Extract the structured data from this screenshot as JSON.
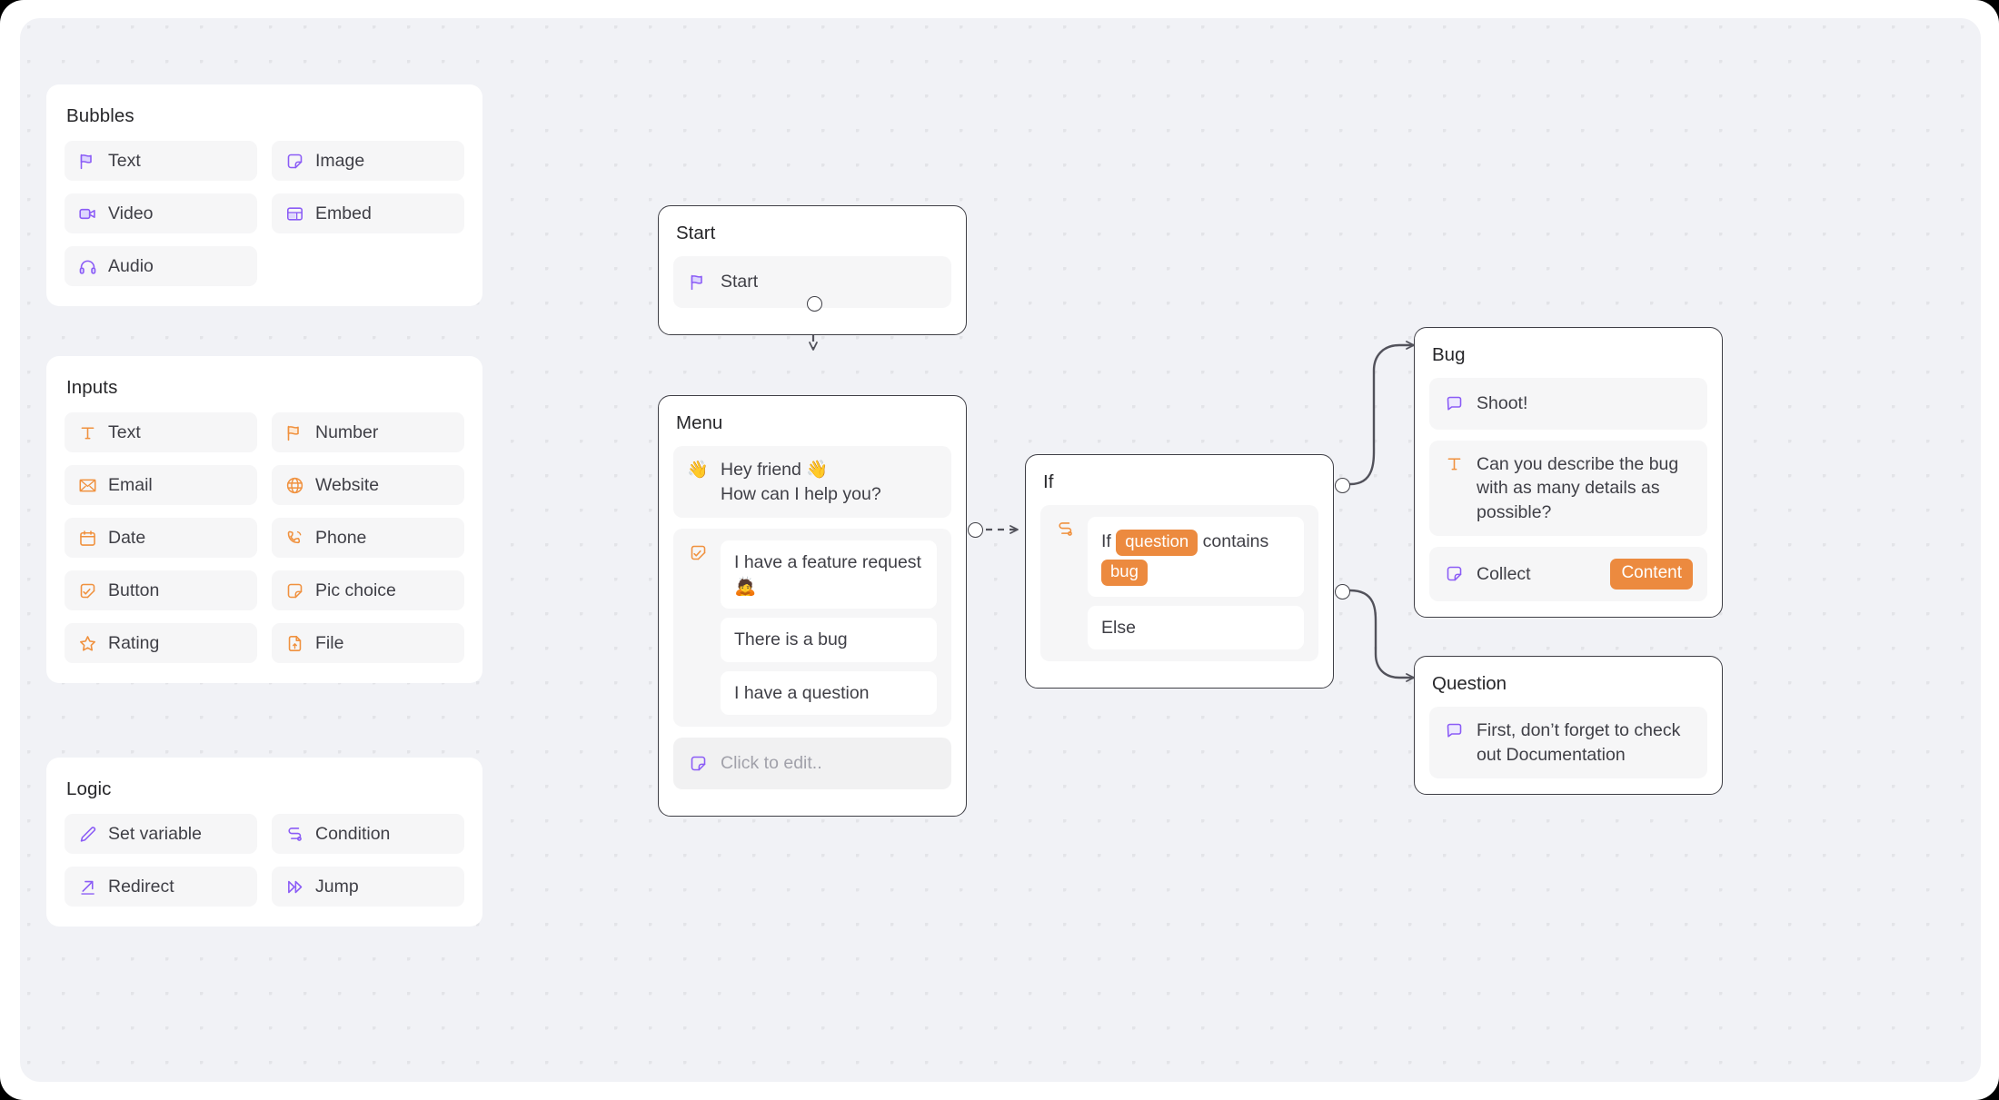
{
  "palette": {
    "sections": [
      {
        "title": "Bubbles",
        "items": [
          {
            "label": "Text",
            "icon": "flag-icon",
            "color": "#8b5cf6"
          },
          {
            "label": "Image",
            "icon": "sticker-icon",
            "color": "#8b5cf6"
          },
          {
            "label": "Video",
            "icon": "video-icon",
            "color": "#8b5cf6"
          },
          {
            "label": "Embed",
            "icon": "embed-icon",
            "color": "#8b5cf6"
          },
          {
            "label": "Audio",
            "icon": "headphones-icon",
            "color": "#8b5cf6"
          }
        ]
      },
      {
        "title": "Inputs",
        "items": [
          {
            "label": "Text",
            "icon": "text-t-icon",
            "color": "#f0913e"
          },
          {
            "label": "Number",
            "icon": "flag-icon",
            "color": "#f0913e"
          },
          {
            "label": "Email",
            "icon": "envelope-icon",
            "color": "#f0913e"
          },
          {
            "label": "Website",
            "icon": "globe-icon",
            "color": "#f0913e"
          },
          {
            "label": "Date",
            "icon": "calendar-icon",
            "color": "#f0913e"
          },
          {
            "label": "Phone",
            "icon": "phone-icon",
            "color": "#f0913e"
          },
          {
            "label": "Button",
            "icon": "button-check-icon",
            "color": "#f0913e"
          },
          {
            "label": "Pic choice",
            "icon": "sticker-icon",
            "color": "#f0913e"
          },
          {
            "label": "Rating",
            "icon": "star-icon",
            "color": "#f0913e"
          },
          {
            "label": "File",
            "icon": "file-upload-icon",
            "color": "#f0913e"
          }
        ]
      },
      {
        "title": "Logic",
        "items": [
          {
            "label": "Set variable",
            "icon": "pencil-icon",
            "color": "#8b5cf6"
          },
          {
            "label": "Condition",
            "icon": "condition-icon",
            "color": "#8b5cf6"
          },
          {
            "label": "Redirect",
            "icon": "arrow-up-right-icon",
            "color": "#8b5cf6"
          },
          {
            "label": "Jump",
            "icon": "jump-icon",
            "color": "#8b5cf6"
          }
        ]
      }
    ]
  },
  "flow": {
    "nodes": {
      "start": {
        "title": "Start",
        "block_label": "Start",
        "block_icon": "flag-icon"
      },
      "menu": {
        "title": "Menu",
        "greeting": "Hey friend 👋\nHow can I help you?",
        "greeting_icon": "wave-icon",
        "choices_icon": "button-check-icon",
        "choices": [
          "I have a feature request 🙇",
          "There is a bug",
          "I have a question"
        ],
        "edit_placeholder": "Click to edit..",
        "edit_icon": "sticker-icon"
      },
      "if": {
        "title": "If",
        "condition_icon": "condition-icon",
        "condition_prefix": "If",
        "condition_variable": "question",
        "condition_operator": "contains",
        "condition_value": "bug",
        "else_label": "Else"
      },
      "bug": {
        "title": "Bug",
        "message": "Shoot!",
        "message_icon": "chat-bubble-icon",
        "question": "Can you describe the bug with as many details as possible?",
        "question_icon": "text-t-icon",
        "collect_label": "Collect",
        "collect_icon": "sticker-icon",
        "collect_badge": "Content"
      },
      "question": {
        "title": "Question",
        "message": "First, don’t forget to check out Documentation",
        "message_icon": "chat-bubble-icon"
      }
    },
    "colors": {
      "accent_purple": "#8b5cf6",
      "accent_orange": "#ec8a3f",
      "node_border": "#3f3f46",
      "edge": "#52525b",
      "canvas_bg": "#f1f2f6",
      "dot_grid": "#e3e4e8"
    }
  }
}
